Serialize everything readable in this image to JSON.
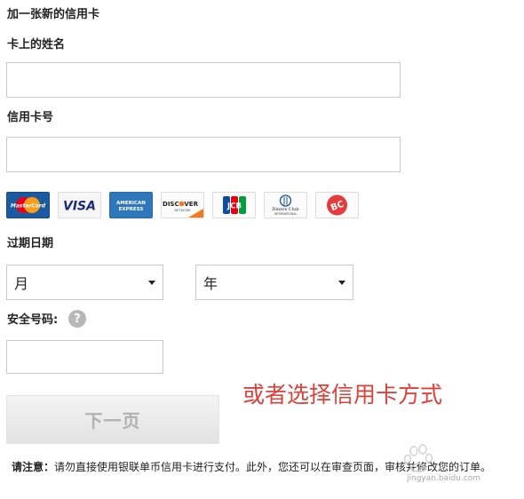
{
  "form": {
    "title": "加一张新的信用卡",
    "name_label": "卡上的姓名",
    "name_value": "",
    "number_label": "信用卡号",
    "number_value": "",
    "card_logos": [
      "MasterCard",
      "VISA",
      "AMERICAN EXPRESS",
      "DISCOVER",
      "JCB",
      "Diners Club",
      "BC"
    ],
    "card_logo_texts": {
      "mastercard": "MasterCard",
      "visa": "VISA",
      "amex_top": "AMERICAN",
      "amex_bottom": "EXPRESS",
      "discover": "DISCOVER",
      "discover_sub": "NETWORK",
      "jcb": "JCB",
      "diners_top": "Diners Club",
      "diners_bottom": "INTERNATIONAL",
      "bc": "BC"
    },
    "expiry_label": "过期日期",
    "month_select": "月",
    "year_select": "年",
    "cvv_label": "安全号码:",
    "help_glyph": "?",
    "cvv_value": "",
    "next_button": "下一页",
    "note_prefix": "请注意：",
    "note_text": "请勿直接使用银联单币信用卡进行支付。此外，您还可以在审查页面，审核并修改您的订单。"
  },
  "annotation": {
    "text": "或者选择信用卡方式",
    "color": "#e0403a"
  },
  "watermark": {
    "text": "jingyan.baidu.com"
  },
  "colors": {
    "mastercard_bg": "#1c5aa0",
    "amex_bg": "#2e77bb",
    "discover_orange": "#f47a20",
    "jcb_blue": "#0b4ea2",
    "jcb_red": "#e60012",
    "jcb_green": "#00a040",
    "bc_red": "#e53b3b",
    "annotation_red": "#e0403a"
  },
  "icons": [
    "mastercard-logo",
    "visa-logo",
    "amex-logo",
    "discover-logo",
    "jcb-logo",
    "diners-club-logo",
    "bc-card-logo",
    "help-icon",
    "chevron-down-icon",
    "baidu-paw-icon"
  ]
}
